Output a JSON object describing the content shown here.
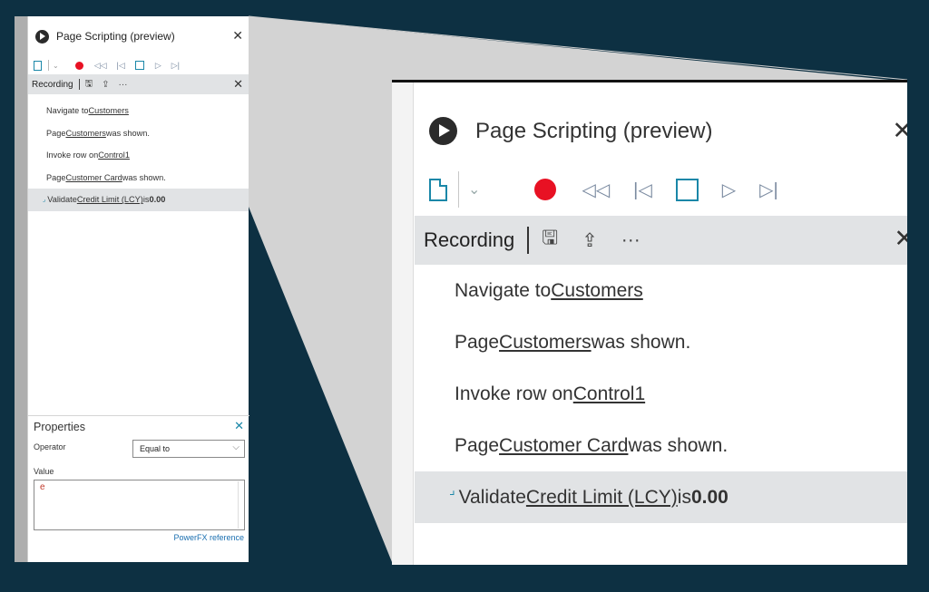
{
  "panel": {
    "title": "Page Scripting (preview)",
    "close_icon": "✕",
    "toolbar": {
      "new_icon": "new-document-icon",
      "dropdown_icon": "chevron-down-icon",
      "record_icon": "record-icon",
      "rewind_icon": "rewind-icon",
      "start_icon": "skip-start-icon",
      "stop_icon": "stop-icon",
      "play_icon": "play-icon",
      "end_icon": "skip-end-icon",
      "dropdown_glyph": "⌄",
      "rewind_glyph": "◁◁",
      "start_glyph": "|◁",
      "play_glyph": "▷",
      "end_glyph": "▷|"
    },
    "recording_bar": {
      "label": "Recording",
      "save_glyph": "🖫",
      "share_glyph": "⇪",
      "more_glyph": "···",
      "close_glyph": "✕"
    },
    "steps": [
      {
        "prefix": "Navigate to ",
        "link": "Customers",
        "suffix": ""
      },
      {
        "prefix": "Page ",
        "link": "Customers",
        "suffix": " was shown."
      },
      {
        "prefix": "Invoke row on ",
        "link": "Control1",
        "suffix": ""
      },
      {
        "prefix": "Page ",
        "link": "Customer Card",
        "suffix": " was shown."
      },
      {
        "prefix": "Validate ",
        "link": "Credit Limit (LCY)",
        "suffix": " is ",
        "bold": "0.00",
        "mark": "⌟",
        "selected": true
      }
    ]
  },
  "properties": {
    "title": "Properties",
    "close_glyph": "✕",
    "operator_label": "Operator",
    "operator_value": "Equal to",
    "chevron_glyph": "⌵",
    "value_label": "Value",
    "value_text": "e",
    "link_text": "PowerFX reference"
  },
  "colors": {
    "background": "#0d3042",
    "accent": "#1a87a8",
    "record": "#e81123",
    "selected_row": "#e1e3e5"
  }
}
